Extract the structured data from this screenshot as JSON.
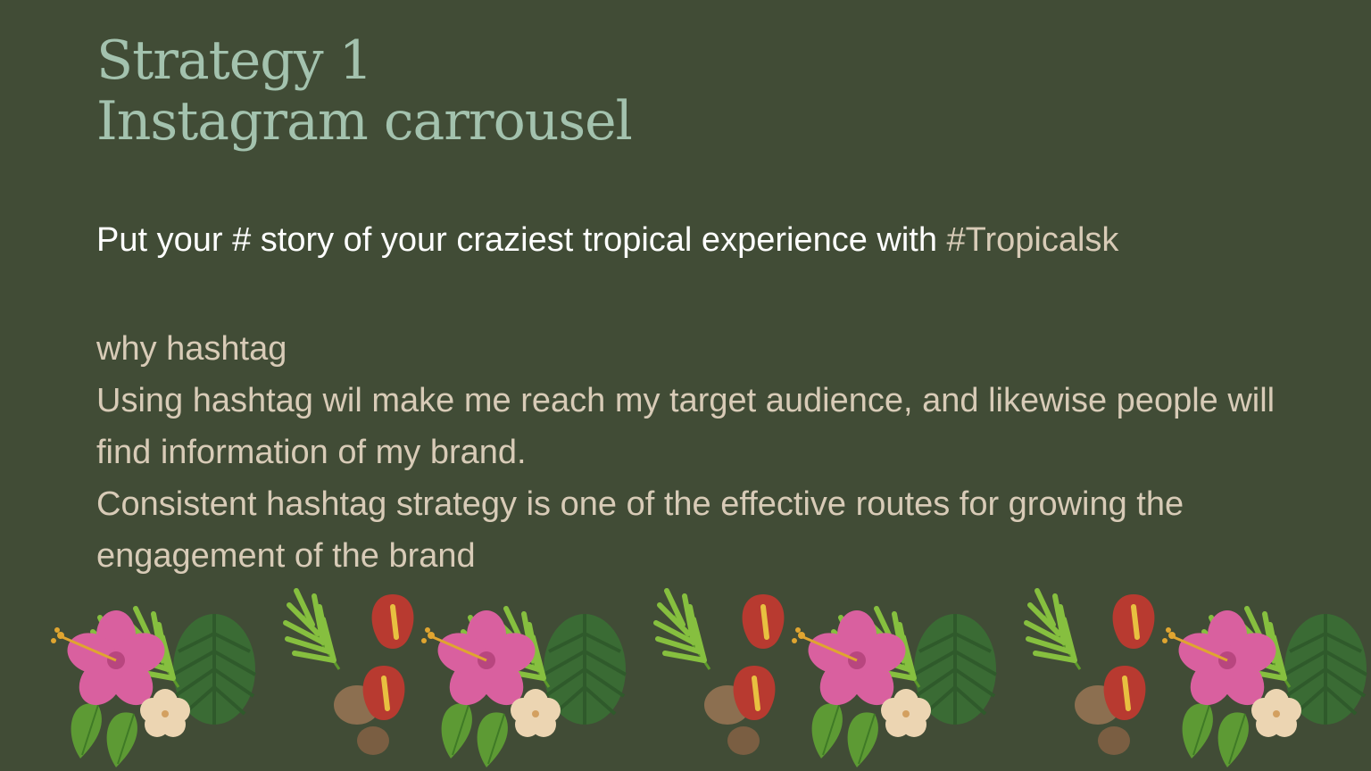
{
  "slide": {
    "title_line1": "Strategy 1",
    "title_line2": "Instagram carrousel",
    "tagline_text": "Put your # story of your craziest tropical experience with ",
    "tagline_hashtag": "#Tropicalsk",
    "subheading": "why hashtag",
    "paragraph1": "Using hashtag wil make me reach my target audience, and likewise people will find information of my brand.",
    "paragraph2": "Consistent hashtag strategy is one of the effective routes for growing the engagement of the brand"
  },
  "colors": {
    "background": "#414c36",
    "title": "#a3c2ae",
    "tagline": "#ffffff",
    "body": "#d8cbb7",
    "hibiscus_pink": "#d9609f",
    "anthurium_red": "#b83a30",
    "leaf_green": "#76ab3a",
    "dark_leaf": "#3a6b34",
    "coconut": "#8c6f50",
    "cream_flower": "#ecd5b2"
  },
  "decoration": {
    "icon": "tropical-floral-border"
  }
}
